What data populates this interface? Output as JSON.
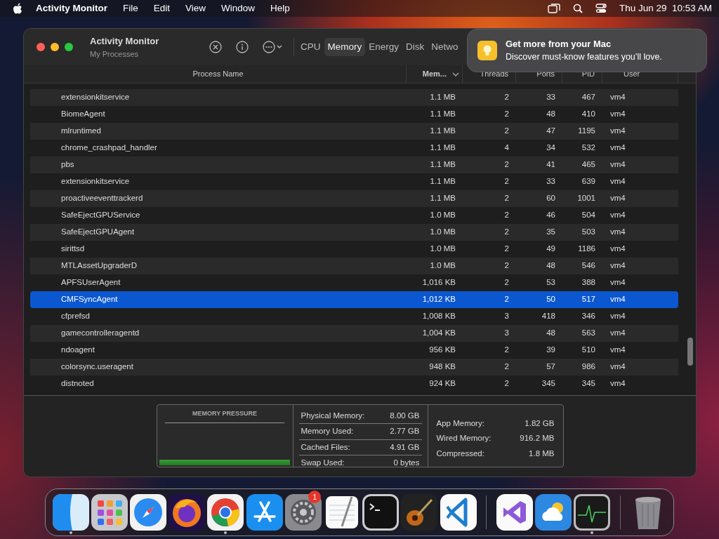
{
  "menu_bar": {
    "app_name": "Activity Monitor",
    "menus": [
      "File",
      "Edit",
      "View",
      "Window",
      "Help"
    ],
    "clock": "Thu Jun 29  10:53 AM"
  },
  "window": {
    "title": "Activity Monitor",
    "subtitle": "My Processes",
    "tabs": [
      {
        "label": "CPU",
        "selected": false
      },
      {
        "label": "Memory",
        "selected": true
      },
      {
        "label": "Energy",
        "selected": false
      },
      {
        "label": "Disk",
        "selected": false
      },
      {
        "label": "Netwo",
        "selected": false
      }
    ],
    "columns": [
      {
        "label": "Process Name",
        "sorted": false
      },
      {
        "label": "Mem...",
        "sorted": true
      },
      {
        "label": "Threads",
        "sorted": false
      },
      {
        "label": "Ports",
        "sorted": false
      },
      {
        "label": "PID",
        "sorted": false
      },
      {
        "label": "User",
        "sorted": false
      }
    ],
    "rows": [
      {
        "cells": [
          "extensionkitservice",
          "1.1 MB",
          "2",
          "33",
          "467",
          "vm4"
        ],
        "selected": false
      },
      {
        "cells": [
          "BiomeAgent",
          "1.1 MB",
          "2",
          "48",
          "410",
          "vm4"
        ],
        "selected": false
      },
      {
        "cells": [
          "mlruntimed",
          "1.1 MB",
          "2",
          "47",
          "1195",
          "vm4"
        ],
        "selected": false
      },
      {
        "cells": [
          "chrome_crashpad_handler",
          "1.1 MB",
          "4",
          "34",
          "532",
          "vm4"
        ],
        "selected": false
      },
      {
        "cells": [
          "pbs",
          "1.1 MB",
          "2",
          "41",
          "465",
          "vm4"
        ],
        "selected": false
      },
      {
        "cells": [
          "extensionkitservice",
          "1.1 MB",
          "2",
          "33",
          "639",
          "vm4"
        ],
        "selected": false
      },
      {
        "cells": [
          "proactiveeventtrackerd",
          "1.1 MB",
          "2",
          "60",
          "1001",
          "vm4"
        ],
        "selected": false
      },
      {
        "cells": [
          "SafeEjectGPUService",
          "1.0 MB",
          "2",
          "46",
          "504",
          "vm4"
        ],
        "selected": false
      },
      {
        "cells": [
          "SafeEjectGPUAgent",
          "1.0 MB",
          "2",
          "35",
          "503",
          "vm4"
        ],
        "selected": false
      },
      {
        "cells": [
          "sirittsd",
          "1.0 MB",
          "2",
          "49",
          "1186",
          "vm4"
        ],
        "selected": false
      },
      {
        "cells": [
          "MTLAssetUpgraderD",
          "1.0 MB",
          "2",
          "48",
          "546",
          "vm4"
        ],
        "selected": false
      },
      {
        "cells": [
          "APFSUserAgent",
          "1,016 KB",
          "2",
          "53",
          "388",
          "vm4"
        ],
        "selected": false
      },
      {
        "cells": [
          "CMFSyncAgent",
          "1,012 KB",
          "2",
          "50",
          "517",
          "vm4"
        ],
        "selected": true
      },
      {
        "cells": [
          "cfprefsd",
          "1,008 KB",
          "3",
          "418",
          "346",
          "vm4"
        ],
        "selected": false
      },
      {
        "cells": [
          "gamecontrolleragentd",
          "1,004 KB",
          "3",
          "48",
          "563",
          "vm4"
        ],
        "selected": false
      },
      {
        "cells": [
          "ndoagent",
          "956 KB",
          "2",
          "39",
          "510",
          "vm4"
        ],
        "selected": false
      },
      {
        "cells": [
          "colorsync.useragent",
          "948 KB",
          "2",
          "57",
          "986",
          "vm4"
        ],
        "selected": false
      },
      {
        "cells": [
          "distnoted",
          "924 KB",
          "2",
          "345",
          "345",
          "vm4"
        ],
        "selected": false
      }
    ],
    "memory_pressure": {
      "title": "MEMORY PRESSURE"
    },
    "stats": [
      {
        "label": "Physical Memory:",
        "value": "8.00 GB"
      },
      {
        "label": "Memory Used:",
        "value": "2.77 GB"
      },
      {
        "label": "Cached Files:",
        "value": "4.91 GB"
      },
      {
        "label": "Swap Used:",
        "value": "0 bytes"
      }
    ],
    "breakdown": [
      {
        "label": "App Memory:",
        "value": "1.82 GB"
      },
      {
        "label": "Wired Memory:",
        "value": "916.2 MB"
      },
      {
        "label": "Compressed:",
        "value": "1.8 MB"
      }
    ]
  },
  "notification": {
    "title": "Get more from your Mac",
    "body": "Discover must-know features you’ll love."
  },
  "dock": [
    {
      "kind": "finder",
      "running": true
    },
    {
      "kind": "launchpad",
      "running": false
    },
    {
      "kind": "safari",
      "running": false
    },
    {
      "kind": "firefox",
      "running": false
    },
    {
      "kind": "chrome",
      "running": true
    },
    {
      "kind": "appstore",
      "running": false
    },
    {
      "kind": "settings",
      "running": false,
      "badge": "1"
    },
    {
      "kind": "textedit",
      "running": false
    },
    {
      "kind": "terminal",
      "running": false
    },
    {
      "kind": "garageband",
      "running": false
    },
    {
      "kind": "vscode",
      "running": false
    },
    {
      "kind": "separator"
    },
    {
      "kind": "visualstudio",
      "running": false
    },
    {
      "kind": "weather",
      "running": false
    },
    {
      "kind": "activity",
      "running": true
    },
    {
      "kind": "separator"
    },
    {
      "kind": "trash",
      "running": false
    }
  ]
}
